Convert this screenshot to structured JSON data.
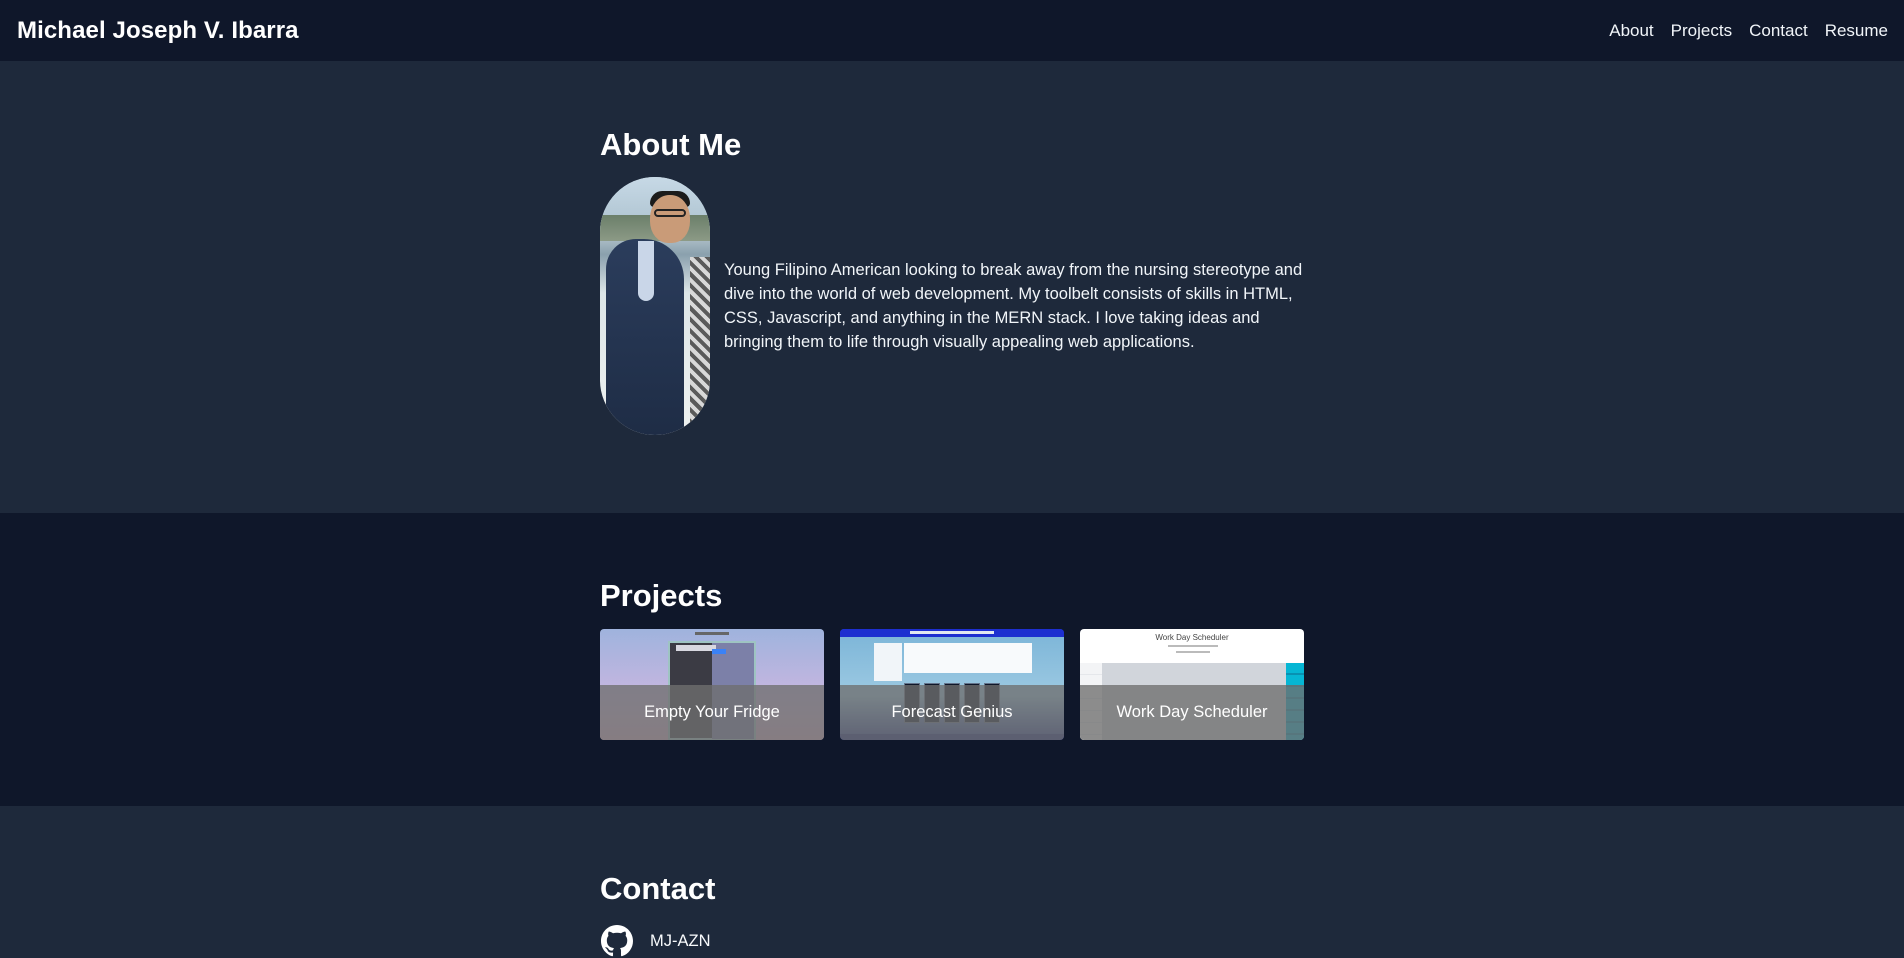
{
  "header": {
    "brand": "Michael Joseph V. Ibarra",
    "nav": [
      {
        "label": "About"
      },
      {
        "label": "Projects"
      },
      {
        "label": "Contact"
      },
      {
        "label": "Resume"
      }
    ]
  },
  "about": {
    "title": "About Me",
    "bio": "Young Filipino American looking to break away from the nursing stereotype and dive into the world of web development. My toolbelt consists of skills in HTML, CSS, Javascript, and anything in the MERN stack. I love taking ideas and bringing them to life through visually appealing web applications."
  },
  "projects": {
    "title": "Projects",
    "items": [
      {
        "label": "Empty Your Fridge"
      },
      {
        "label": "Forecast Genius"
      },
      {
        "label": "Work Day Scheduler",
        "thumb_title": "Work Day Scheduler"
      }
    ]
  },
  "contact": {
    "title": "Contact",
    "github_handle": "MJ-AZN",
    "icon": "github-icon"
  },
  "colors": {
    "header_bg": "#0f172a",
    "section_light": "#1e293b",
    "section_dark": "#0f172a",
    "text": "#f8fafc"
  }
}
